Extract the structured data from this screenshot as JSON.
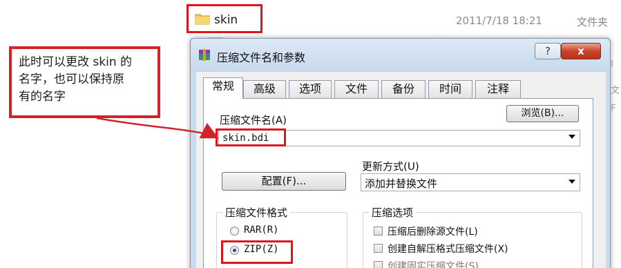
{
  "explorer": {
    "file": {
      "name": "skin",
      "date": "2011/7/18 18:21",
      "type": "文件夹",
      "icon": "folder-icon"
    }
  },
  "callout": {
    "text": "此时可以更改 skin 的名字，也可以保持原有的名字",
    "lines": [
      "此时可以更改 skin 的",
      "名字，也可以保持原",
      "有的名字"
    ]
  },
  "dialog": {
    "title": "压缩文件名和参数",
    "help_label": "?",
    "close_label": "x",
    "tabs": [
      {
        "label": "常规",
        "active": true
      },
      {
        "label": "高级"
      },
      {
        "label": "选项"
      },
      {
        "label": "文件"
      },
      {
        "label": "备份"
      },
      {
        "label": "时间"
      },
      {
        "label": "注释"
      }
    ],
    "archive_name_label": "压缩文件名(A)",
    "browse_label": "浏览(B)...",
    "archive_name_value": "skin.bdi",
    "update_mode_label": "更新方式(U)",
    "update_mode_value": "添加并替换文件",
    "config_label": "配置(F)...",
    "format_group_title": "压缩文件格式",
    "formats": [
      {
        "label": "RAR(R)",
        "selected": false
      },
      {
        "label": "ZIP(Z)",
        "selected": true
      }
    ],
    "options_group_title": "压缩选项",
    "options": [
      {
        "label": "压缩后删除源文件(L)",
        "checked": false
      },
      {
        "label": "创建自解压格式压缩文件(X)",
        "checked": false
      },
      {
        "label": "创建固实压缩文件(S)",
        "checked": false
      }
    ]
  },
  "colors": {
    "highlight": "#e0121a",
    "callout_border": "#d2232a",
    "dialog_frame": "#c9dcef",
    "close_button": "#c8442c"
  }
}
